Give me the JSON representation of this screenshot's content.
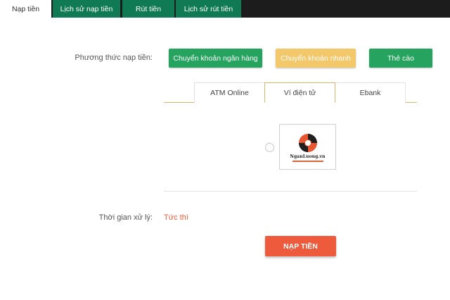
{
  "top_tabs": [
    {
      "label": "Nạp tiền",
      "active": true
    },
    {
      "label": "Lịch sử nạp tiền",
      "active": false
    },
    {
      "label": "Rút tiền",
      "active": false
    },
    {
      "label": "Lịch sử rút tiền",
      "active": false
    }
  ],
  "method": {
    "label": "Phương thức nạp tiền:",
    "buttons": [
      {
        "label": "Chuyển khoản ngân hàng",
        "color": "#25a35f"
      },
      {
        "label": "Chuyển khoản nhanh",
        "color": "#f2c86b"
      },
      {
        "label": "Thẻ cào",
        "color": "#25a35f"
      }
    ]
  },
  "sub_tabs": [
    {
      "label": "ATM Online",
      "active": false
    },
    {
      "label": "Ví điện tử",
      "active": true
    },
    {
      "label": "Ebank",
      "active": false
    }
  ],
  "wallet_option": {
    "logo_text": "NganLuong.vn",
    "selected": false,
    "logo_icon": "nganluong-swirl-logo"
  },
  "processing": {
    "label": "Thời gian xử lý:",
    "value": "Tức thì"
  },
  "submit": {
    "label": "NẠP TIỀN"
  },
  "colors": {
    "topbar_bg": "#1c1c1c",
    "tab_green": "#0f7a53",
    "button_green": "#25a35f",
    "button_yellow": "#f2c86b",
    "accent_red": "#ee5a3c",
    "tab_border_gold": "#d9b46a"
  }
}
